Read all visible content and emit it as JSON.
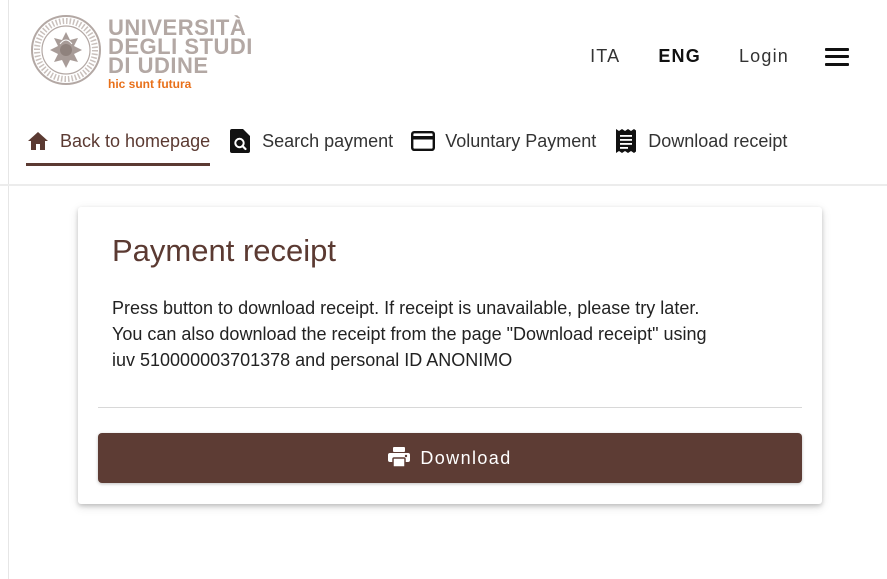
{
  "header": {
    "logo": {
      "lines": [
        "UNIVERSITÀ",
        "DEGLI STUDI",
        "DI UDINE"
      ],
      "motto": "hic sunt futura",
      "icon": "university-seal-icon"
    },
    "actions": {
      "ita": "ITA",
      "eng": "ENG",
      "login": "Login",
      "active_language": "ENG",
      "menu_icon": "hamburger-menu-icon"
    }
  },
  "nav": {
    "tabs": [
      {
        "label": "Back to homepage",
        "icon": "home-icon",
        "active": true
      },
      {
        "label": "Search payment",
        "icon": "search-document-icon",
        "active": false
      },
      {
        "label": "Voluntary Payment",
        "icon": "credit-card-icon",
        "active": false
      },
      {
        "label": "Download receipt",
        "icon": "receipt-icon",
        "active": false
      }
    ]
  },
  "card": {
    "title": "Payment receipt",
    "body_lines": [
      "Press button to download receipt. If receipt is unavailable, please try later.",
      "You can also download the receipt from the page \"Download receipt\" using",
      "iuv 510000003701378 and personal ID ANONIMO"
    ],
    "button": {
      "label": "Download",
      "icon": "printer-icon"
    }
  },
  "colors": {
    "brand": "#5d3c34",
    "logo_text": "#b3a8a4",
    "motto": "#e8701a"
  }
}
